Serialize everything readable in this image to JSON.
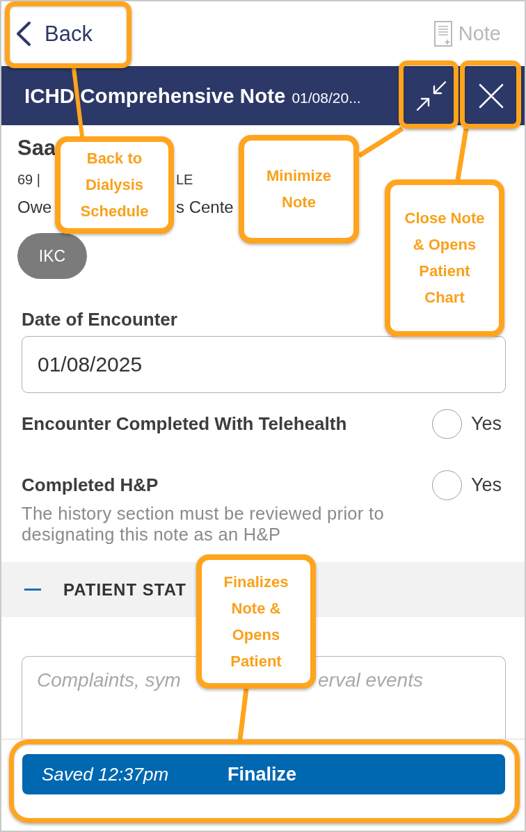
{
  "nav": {
    "back": {
      "label": "Back"
    },
    "note": {
      "label": "Note",
      "disabled": true
    }
  },
  "header": {
    "title": "ICHD Comprehensive Note",
    "date": "01/08/20..."
  },
  "patient": {
    "name": "Saa",
    "details": [
      "69 |",
      "LE"
    ],
    "location": [
      "Owe",
      "s Cente"
    ],
    "tag": "IKC"
  },
  "form": {
    "date": {
      "label": "Date of Encounter",
      "value": "01/08/2025"
    },
    "options": [
      {
        "label": "Encounter Completed With Telehealth",
        "option": "Yes",
        "selected": false
      },
      {
        "label": "Completed H&P",
        "option": "Yes",
        "selected": false,
        "help": "The history section must be reviewed prior to designating this note as an H&P"
      }
    ]
  },
  "section": {
    "title": "PATIENT STAT",
    "expanded": true
  },
  "notes_field": {
    "placeholder_parts": [
      "Complaints, sym",
      "erval events"
    ]
  },
  "footer": {
    "status": "Saved 12:37pm",
    "button": "Finalize"
  },
  "callouts": [
    {
      "lines": [
        "Back to",
        "Dialysis",
        "Schedule"
      ]
    },
    {
      "lines": [
        "Minimize",
        "Note"
      ]
    },
    {
      "lines": [
        "Close Note",
        "& Opens",
        "Patient",
        "Chart"
      ]
    },
    {
      "lines": [
        "Finalizes",
        "Note &",
        "Opens",
        "Patient"
      ]
    }
  ]
}
